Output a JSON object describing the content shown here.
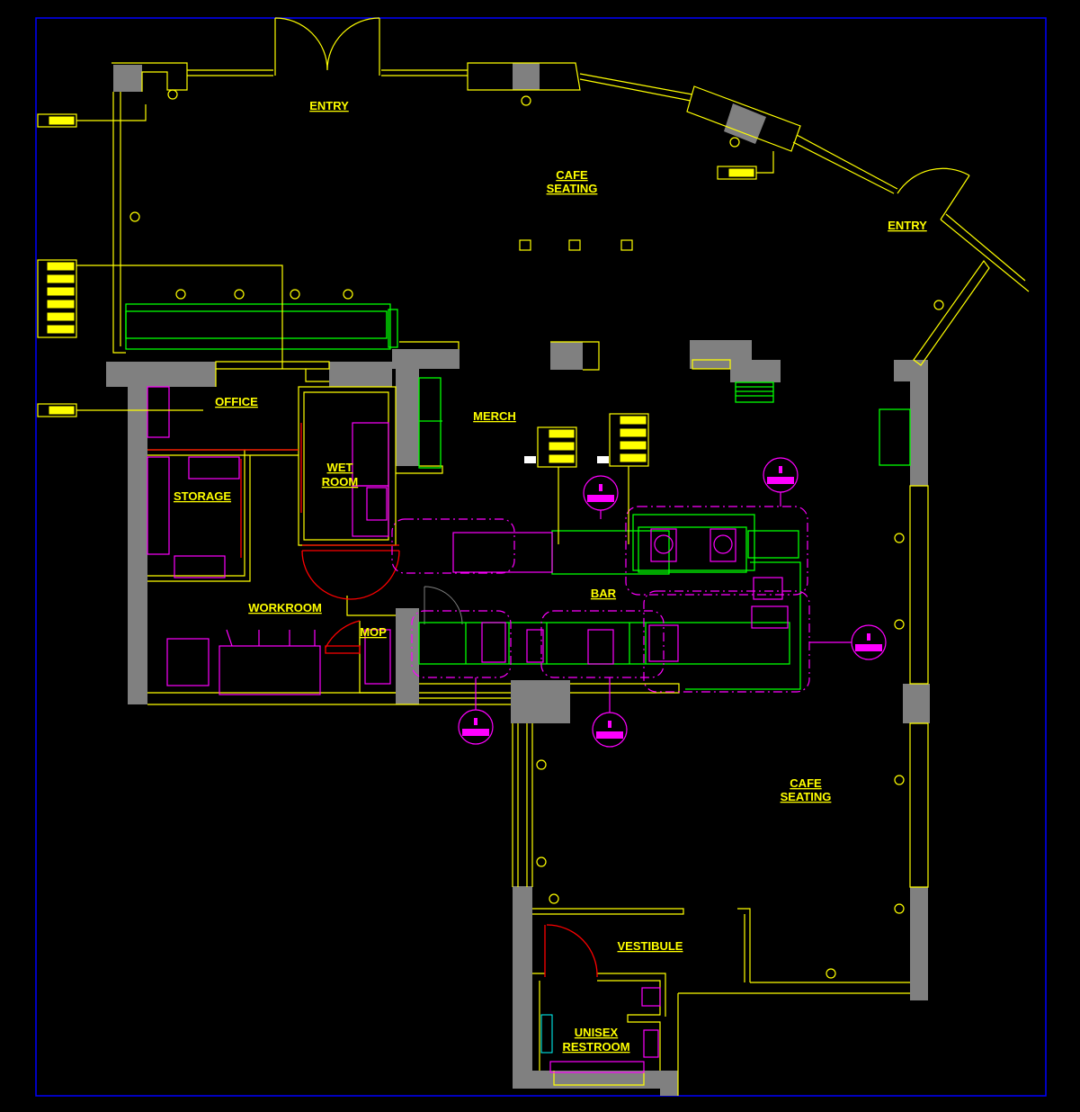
{
  "colors": {
    "background": "#000000",
    "frame": "#0000ff",
    "walls": "#808080",
    "linework": "#ffff00",
    "equipment": "#00ff00",
    "fixtures": "#ff00ff",
    "doors": "#ff0000"
  },
  "rooms": {
    "entry_north": "ENTRY",
    "cafe_seating_north": [
      "CAFE",
      "SEATING"
    ],
    "entry_east": "ENTRY",
    "office": "OFFICE",
    "merch": "MERCH",
    "wet_room": [
      "WET",
      "ROOM"
    ],
    "storage": "STORAGE",
    "bar": "BAR",
    "workroom": "WORKROOM",
    "mop": "MOP",
    "cafe_seating_south": [
      "CAFE",
      "SEATING"
    ],
    "vestibule": "VESTIBULE",
    "unisex_restroom": [
      "UNISEX",
      "RESTROOM"
    ]
  },
  "icons": {
    "receptacle": "duplex-outlet-icon",
    "panel": "electrical-panel-icon",
    "section": "section-marker-icon"
  }
}
